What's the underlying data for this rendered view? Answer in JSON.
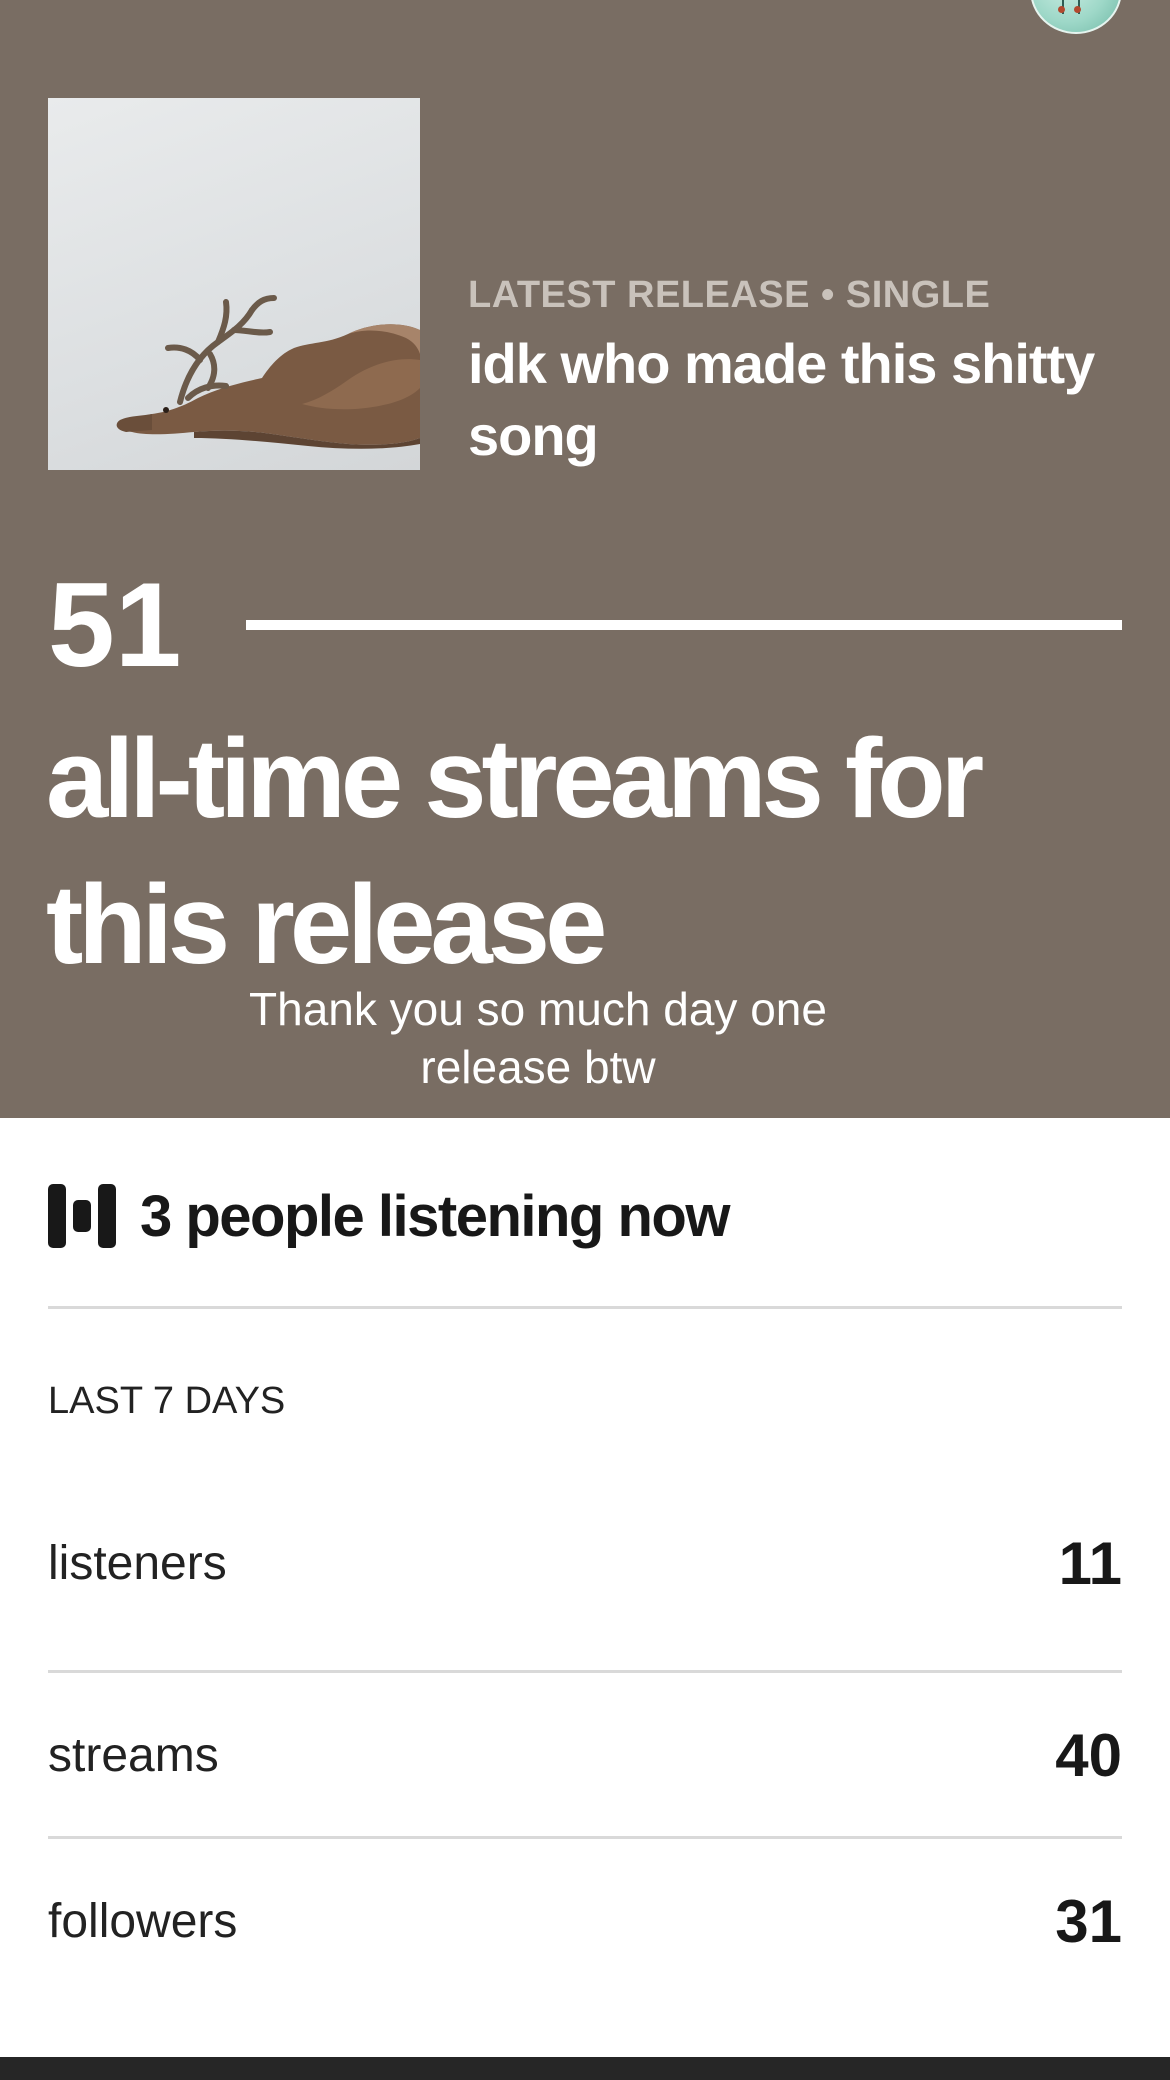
{
  "colors": {
    "hero_background": "#796d63",
    "kicker_text": "#c9c2bb",
    "hero_text": "#ffffff",
    "body_text": "#181818",
    "divider": "#d9d9d9",
    "bottom_bar": "#262626"
  },
  "header": {
    "avatar_icon": "profile-avatar"
  },
  "release": {
    "kicker": "LATEST RELEASE • SINGLE",
    "title": "idk who made this shitty song",
    "cover_icon": "album-cover-deer"
  },
  "streams": {
    "count": "51",
    "caption": "all-time streams for this release",
    "note": "Thank you so much day one release btw"
  },
  "live": {
    "icon": "equalizer-icon",
    "text": "3 people listening now"
  },
  "last7": {
    "label": "LAST 7 DAYS",
    "stats": [
      {
        "label": "listeners",
        "value": "11"
      },
      {
        "label": "streams",
        "value": "40"
      },
      {
        "label": "followers",
        "value": "31"
      }
    ]
  }
}
